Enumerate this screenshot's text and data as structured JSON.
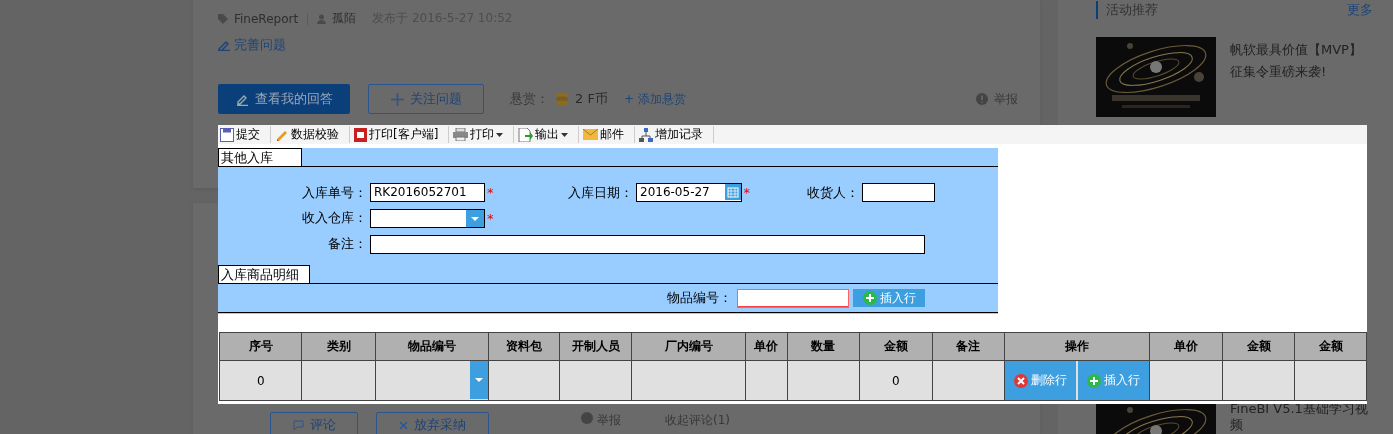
{
  "question": {
    "tag": "FineReport",
    "author": "孤陌",
    "posted": "发布于 2016-5-27 10:52",
    "improve_link": "完善问题",
    "actions": {
      "my_answer": "查看我的回答",
      "follow": "关注问题",
      "bounty_label": "悬赏：",
      "bounty_amount": "2 F币",
      "add_bounty": "+ 添加悬赏",
      "report": "举报"
    }
  },
  "answer": {
    "buttons": [
      {
        "label": "评论",
        "kind": "comment"
      },
      {
        "label": "放弃采纳",
        "kind": "abandon"
      }
    ],
    "report": "举报",
    "collapse": "收起评论(1)"
  },
  "sidebar": {
    "title": "活动推荐",
    "more": "更多",
    "items": [
      {
        "kind": "picture",
        "title": "帆软最具价值【MVP】征集令重磅来袭!"
      },
      {
        "kind": "picture",
        "title": "FineBI V5.1基础学习视频"
      }
    ]
  },
  "report_dialog": {
    "toolbar": [
      {
        "label": "提交",
        "kind": "save",
        "dropdown": false
      },
      {
        "label": "数据校验",
        "kind": "check",
        "dropdown": false
      },
      {
        "label": "打印[客户端]",
        "kind": "client-print",
        "dropdown": false
      },
      {
        "label": "打印",
        "kind": "print",
        "dropdown": true
      },
      {
        "label": "输出",
        "kind": "export",
        "dropdown": true
      },
      {
        "label": "邮件",
        "kind": "mail",
        "dropdown": false
      },
      {
        "label": "增加记录",
        "kind": "add-record",
        "dropdown": false
      }
    ],
    "form": {
      "tab": "其他入库",
      "required_mark": "*",
      "rows": [
        [
          {
            "label": "入库单号：",
            "kind": "text",
            "value": "RK2016052701",
            "required": true
          },
          {
            "label": "入库日期：",
            "kind": "date",
            "value": "2016-05-27",
            "required": true
          },
          {
            "label": "收货人：",
            "kind": "text",
            "required": false
          }
        ],
        [
          {
            "label": "收入仓库：",
            "kind": "select",
            "required": true
          }
        ],
        [
          {
            "label": "备注：",
            "kind": "memo",
            "required": false
          }
        ]
      ]
    },
    "detail": {
      "tab": "入库商品明细",
      "search_label": "物品编号：",
      "search_invalid": true,
      "insert_button": "插入行"
    },
    "table": {
      "columns": [
        "序号",
        "类别",
        "物品编号",
        "资料包",
        "开制人员",
        "厂内编号",
        "单价",
        "数量",
        "金额",
        "备注",
        "操作",
        "单价",
        "金额",
        "金额"
      ],
      "rows": [
        {
          "cells": [
            {
              "kind": "text",
              "value": "0"
            },
            {
              "kind": "text"
            },
            {
              "kind": "select"
            },
            {
              "kind": "text"
            },
            {
              "kind": "text"
            },
            {
              "kind": "text"
            },
            {
              "kind": "text"
            },
            {
              "kind": "text"
            },
            {
              "kind": "text",
              "value": "0"
            },
            {
              "kind": "text"
            },
            {
              "kind": "actions",
              "buttons": [
                {
                  "label": "删除行",
                  "kind": "delete"
                },
                {
                  "label": "插入行",
                  "kind": "insert"
                }
              ]
            },
            {
              "kind": "text"
            },
            {
              "kind": "text"
            },
            {
              "kind": "text"
            }
          ]
        }
      ]
    }
  }
}
